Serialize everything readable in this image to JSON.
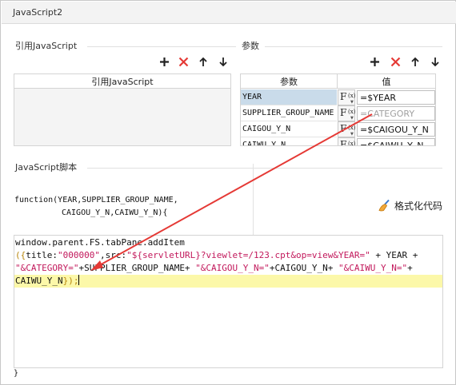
{
  "window": {
    "title": "JavaScript2"
  },
  "ref_section": {
    "label": "引用JavaScript",
    "column_header": "引用JavaScript"
  },
  "params_section": {
    "label": "参数",
    "columns": [
      "参数",
      "值"
    ],
    "rows": [
      {
        "name": "YEAR",
        "value": "=$YEAR",
        "selected": true,
        "placeholder": false
      },
      {
        "name": "SUPPLIER_GROUP_NAME",
        "value": "=CATEGORY",
        "selected": false,
        "placeholder": true
      },
      {
        "name": "CAIGOU_Y_N",
        "value": "=$CAIGOU_Y_N",
        "selected": false,
        "placeholder": false
      },
      {
        "name": "CAIWU_Y_N",
        "value": "=$CAIWU_Y_N",
        "selected": false,
        "placeholder": false
      }
    ],
    "fx_label": "F",
    "fx_sub": "(x)"
  },
  "toolbar_icons": [
    "add-icon",
    "delete-icon",
    "move-up-icon",
    "move-down-icon"
  ],
  "script_section": {
    "label": "JavaScript脚本",
    "signature_line1": "function(YEAR,SUPPLIER_GROUP_NAME,",
    "signature_line2": "CAIGOU_Y_N,CAIWU_Y_N){",
    "format_button": "格式化代码",
    "closing_brace": "}"
  },
  "code": {
    "line1": "window.parent.FS.tabPane.addItem",
    "line2a": "({",
    "line2b": "title:",
    "line2c": "\"000000\"",
    "line2d": ",src:",
    "line2e": "\"${servletURL}?viewlet=/123.cpt&op=view&YEAR=\"",
    "line2f": " + YEAR +",
    "line3a": "\"&CATEGORY=\"",
    "line3b": "+SUPPLIER_GROUP_NAME+ ",
    "line3c": "\"&CAIGOU_Y_N=\"",
    "line3d": "+CAIGOU_Y_N+ ",
    "line3e": "\"&CAIWU_Y_N=\"",
    "line3f": "+",
    "line4a": "CAIWU_Y_N",
    "line4b": "});"
  },
  "colors": {
    "accent_red": "#e53935",
    "selection": "#c9dbea",
    "highlight": "#fcf8a9",
    "string": "#c2185b"
  }
}
